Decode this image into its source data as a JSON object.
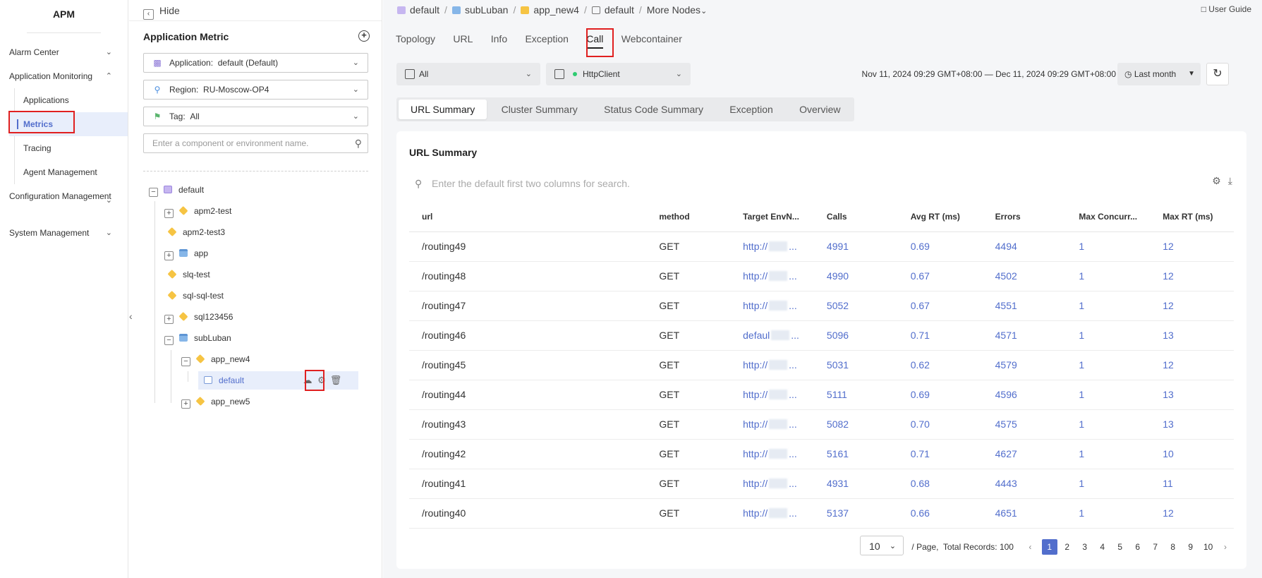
{
  "nav": {
    "brand": "APM",
    "items": [
      {
        "label": "Alarm Center",
        "chev": "⌄"
      },
      {
        "label": "Application Monitoring",
        "chev": "⌃"
      },
      {
        "label": "Configuration Management",
        "chev": "⌄"
      },
      {
        "label": "System Management",
        "chev": "⌄"
      }
    ],
    "sub": [
      "Applications",
      "Metrics",
      "Tracing",
      "Agent Management"
    ],
    "active_sub": "Metrics"
  },
  "tree": {
    "hide_label": "Hide",
    "title": "Application Metric",
    "application": {
      "label": "Application:",
      "value": "default (Default)"
    },
    "region": {
      "label": "Region:",
      "value": "RU-Moscow-OP4"
    },
    "tag": {
      "label": "Tag:",
      "value": "All"
    },
    "search_placeholder": "Enter a component or environment name.",
    "nodes": [
      "default",
      "apm2-test",
      "apm2-test3",
      "app",
      "slq-test",
      "sql-sql-test",
      "sql123456",
      "subLuban",
      "app_new4",
      "default",
      "app_new5"
    ]
  },
  "breadcrumb": [
    "default",
    "subLuban",
    "app_new4",
    "default",
    "More Nodes"
  ],
  "user_guide": "User Guide",
  "tabs": [
    "Topology",
    "URL",
    "Info",
    "Exception",
    "Call",
    "Webcontainer"
  ],
  "active_tab": "Call",
  "filters": {
    "scope": "All",
    "type": "HttpClient",
    "date_range": "Nov 11, 2024 09:29 GMT+08:00 — Dec 11, 2024 09:29 GMT+08:00",
    "period": "Last month"
  },
  "subtabs": [
    "URL Summary",
    "Cluster Summary",
    "Status Code Summary",
    "Exception",
    "Overview"
  ],
  "active_subtab": "URL Summary",
  "card": {
    "title": "URL Summary",
    "search_placeholder": "Enter the default first two columns for search."
  },
  "table": {
    "headers": [
      "url",
      "method",
      "Target EnvN...",
      "Calls",
      "Avg RT (ms)",
      "Errors",
      "Max Concurr...",
      "Max RT (ms)"
    ],
    "rows": [
      {
        "url": "/routing49",
        "method": "GET",
        "target": "http://",
        "tail": "...",
        "calls": "4991",
        "avg": "0.69",
        "errors": "4494",
        "maxc": "1",
        "maxrt": "12"
      },
      {
        "url": "/routing48",
        "method": "GET",
        "target": "http://",
        "tail": "...",
        "calls": "4990",
        "avg": "0.67",
        "errors": "4502",
        "maxc": "1",
        "maxrt": "12"
      },
      {
        "url": "/routing47",
        "method": "GET",
        "target": "http://",
        "tail": "...",
        "calls": "5052",
        "avg": "0.67",
        "errors": "4551",
        "maxc": "1",
        "maxrt": "12"
      },
      {
        "url": "/routing46",
        "method": "GET",
        "target": "defaul",
        "tail": "...",
        "calls": "5096",
        "avg": "0.71",
        "errors": "4571",
        "maxc": "1",
        "maxrt": "13"
      },
      {
        "url": "/routing45",
        "method": "GET",
        "target": "http://",
        "tail": "...",
        "calls": "5031",
        "avg": "0.62",
        "errors": "4579",
        "maxc": "1",
        "maxrt": "12"
      },
      {
        "url": "/routing44",
        "method": "GET",
        "target": "http://",
        "tail": "...",
        "calls": "5111",
        "avg": "0.69",
        "errors": "4596",
        "maxc": "1",
        "maxrt": "13"
      },
      {
        "url": "/routing43",
        "method": "GET",
        "target": "http://",
        "tail": "...",
        "calls": "5082",
        "avg": "0.70",
        "errors": "4575",
        "maxc": "1",
        "maxrt": "13"
      },
      {
        "url": "/routing42",
        "method": "GET",
        "target": "http://",
        "tail": "...",
        "calls": "5161",
        "avg": "0.71",
        "errors": "4627",
        "maxc": "1",
        "maxrt": "10"
      },
      {
        "url": "/routing41",
        "method": "GET",
        "target": "http://",
        "tail": "...",
        "calls": "4931",
        "avg": "0.68",
        "errors": "4443",
        "maxc": "1",
        "maxrt": "11"
      },
      {
        "url": "/routing40",
        "method": "GET",
        "target": "http://",
        "tail": "...",
        "calls": "5137",
        "avg": "0.66",
        "errors": "4651",
        "maxc": "1",
        "maxrt": "12"
      }
    ]
  },
  "pager": {
    "page_size": "10",
    "per_page_label": "/ Page,",
    "total_label": "Total Records: 100",
    "pages": [
      "1",
      "2",
      "3",
      "4",
      "5",
      "6",
      "7",
      "8",
      "9",
      "10"
    ],
    "current": "1"
  },
  "colors": {
    "accent": "#526ecc",
    "highlight_box": "#e02020",
    "status_dot": "#2ecc71"
  }
}
